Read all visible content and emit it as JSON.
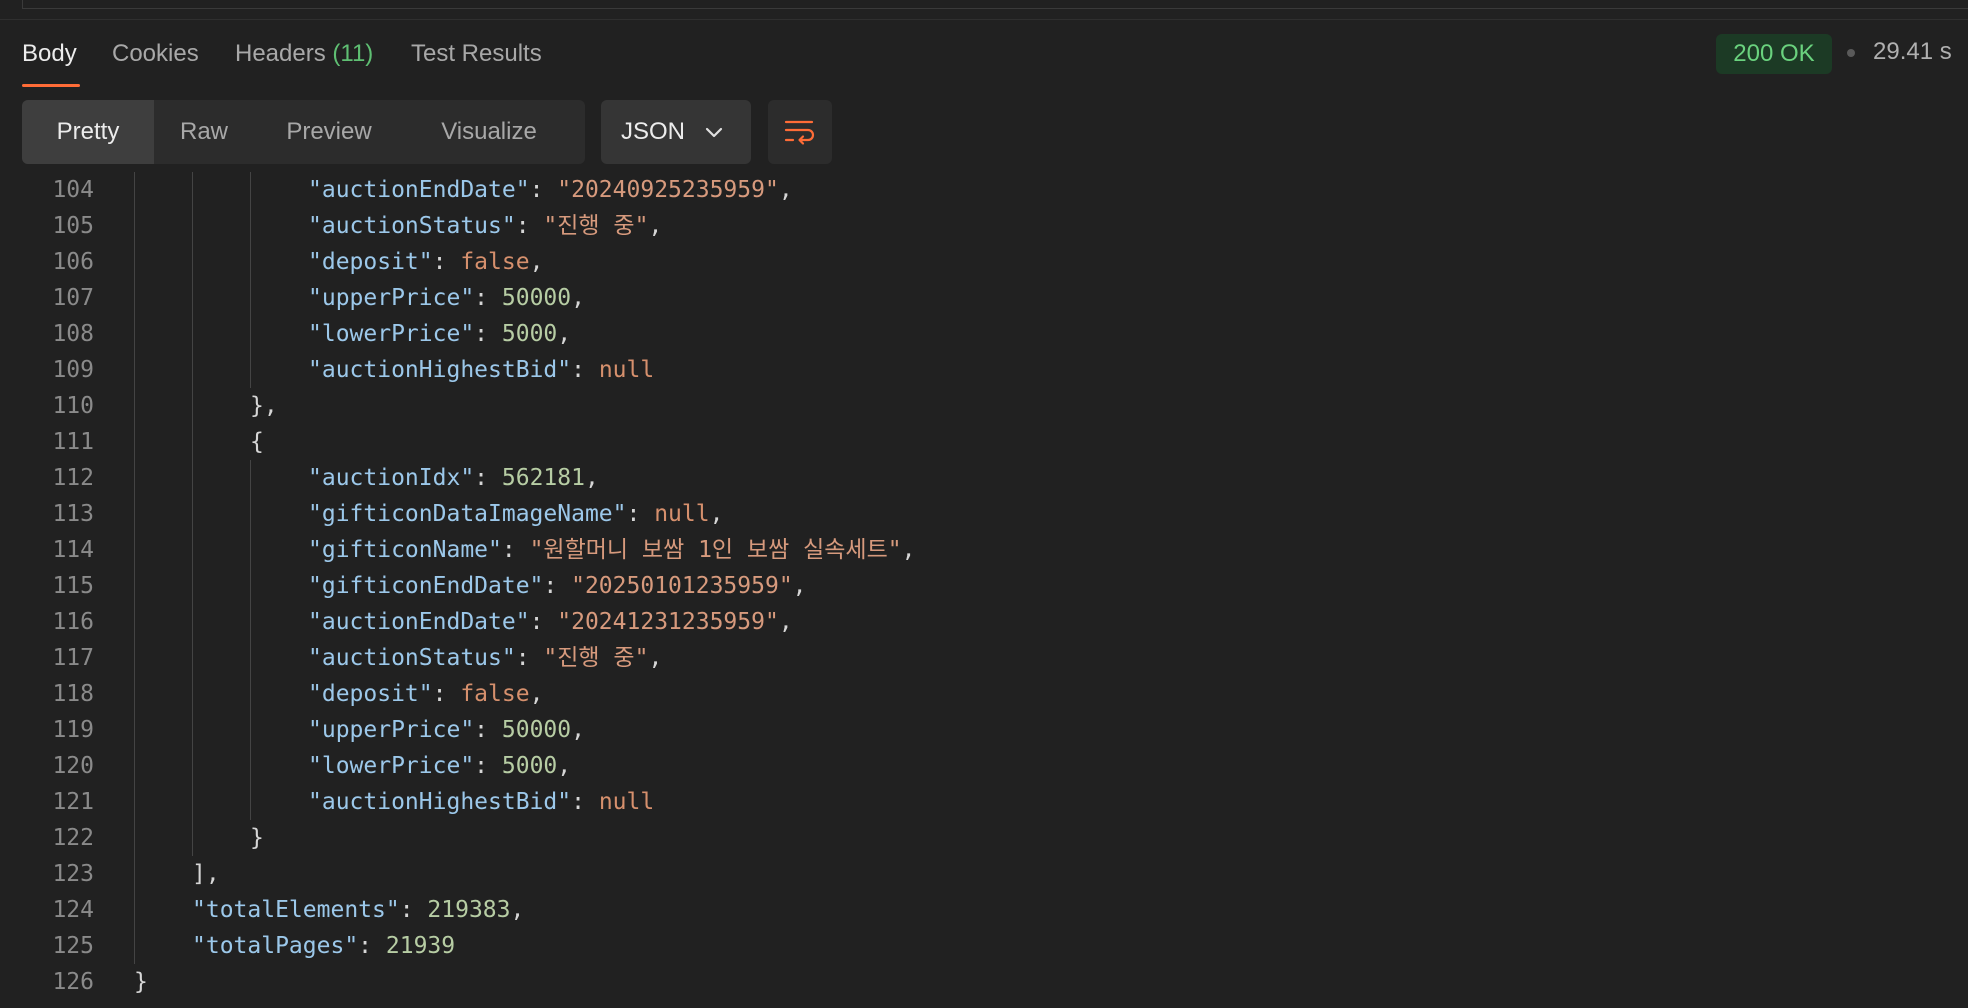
{
  "response_tabs": {
    "body": "Body",
    "cookies": "Cookies",
    "headers": "Headers",
    "headers_count": "(11)",
    "test_results": "Test Results"
  },
  "status": {
    "code": "200 OK",
    "time": "29.41 s"
  },
  "view_modes": {
    "pretty": "Pretty",
    "raw": "Raw",
    "preview": "Preview",
    "visualize": "Visualize"
  },
  "format": {
    "selected": "JSON"
  },
  "icons": {
    "dropdown": "chevron-down-icon",
    "wrap": "wrap-lines-icon"
  },
  "colors": {
    "accent": "#ff6c37",
    "status_ok": "#6ad27e",
    "json_key": "#9cc8ea",
    "json_string": "#d79a7d",
    "json_number": "#b7cda4",
    "json_keyword": "#d6906d"
  },
  "code": {
    "lines": [
      {
        "num": "104",
        "indent": 3,
        "tokens": [
          [
            "k",
            "\"auctionEndDate\""
          ],
          [
            "p",
            ": "
          ],
          [
            "s",
            "\"20240925235959\""
          ],
          [
            "p",
            ","
          ]
        ]
      },
      {
        "num": "105",
        "indent": 3,
        "tokens": [
          [
            "k",
            "\"auctionStatus\""
          ],
          [
            "p",
            ": "
          ],
          [
            "s",
            "\"진행 중\""
          ],
          [
            "p",
            ","
          ]
        ]
      },
      {
        "num": "106",
        "indent": 3,
        "tokens": [
          [
            "k",
            "\"deposit\""
          ],
          [
            "p",
            ": "
          ],
          [
            "kw",
            "false"
          ],
          [
            "p",
            ","
          ]
        ]
      },
      {
        "num": "107",
        "indent": 3,
        "tokens": [
          [
            "k",
            "\"upperPrice\""
          ],
          [
            "p",
            ": "
          ],
          [
            "n",
            "50000"
          ],
          [
            "p",
            ","
          ]
        ]
      },
      {
        "num": "108",
        "indent": 3,
        "tokens": [
          [
            "k",
            "\"lowerPrice\""
          ],
          [
            "p",
            ": "
          ],
          [
            "n",
            "5000"
          ],
          [
            "p",
            ","
          ]
        ]
      },
      {
        "num": "109",
        "indent": 3,
        "tokens": [
          [
            "k",
            "\"auctionHighestBid\""
          ],
          [
            "p",
            ": "
          ],
          [
            "kw",
            "null"
          ]
        ]
      },
      {
        "num": "110",
        "indent": 2,
        "tokens": [
          [
            "p",
            "},"
          ]
        ]
      },
      {
        "num": "111",
        "indent": 2,
        "tokens": [
          [
            "p",
            "{"
          ]
        ]
      },
      {
        "num": "112",
        "indent": 3,
        "tokens": [
          [
            "k",
            "\"auctionIdx\""
          ],
          [
            "p",
            ": "
          ],
          [
            "n",
            "562181"
          ],
          [
            "p",
            ","
          ]
        ]
      },
      {
        "num": "113",
        "indent": 3,
        "tokens": [
          [
            "k",
            "\"gifticonDataImageName\""
          ],
          [
            "p",
            ": "
          ],
          [
            "kw",
            "null"
          ],
          [
            "p",
            ","
          ]
        ]
      },
      {
        "num": "114",
        "indent": 3,
        "tokens": [
          [
            "k",
            "\"gifticonName\""
          ],
          [
            "p",
            ": "
          ],
          [
            "s",
            "\"원할머니 보쌈 1인 보쌈 실속세트\""
          ],
          [
            "p",
            ","
          ]
        ]
      },
      {
        "num": "115",
        "indent": 3,
        "tokens": [
          [
            "k",
            "\"gifticonEndDate\""
          ],
          [
            "p",
            ": "
          ],
          [
            "s",
            "\"20250101235959\""
          ],
          [
            "p",
            ","
          ]
        ]
      },
      {
        "num": "116",
        "indent": 3,
        "tokens": [
          [
            "k",
            "\"auctionEndDate\""
          ],
          [
            "p",
            ": "
          ],
          [
            "s",
            "\"20241231235959\""
          ],
          [
            "p",
            ","
          ]
        ]
      },
      {
        "num": "117",
        "indent": 3,
        "tokens": [
          [
            "k",
            "\"auctionStatus\""
          ],
          [
            "p",
            ": "
          ],
          [
            "s",
            "\"진행 중\""
          ],
          [
            "p",
            ","
          ]
        ]
      },
      {
        "num": "118",
        "indent": 3,
        "tokens": [
          [
            "k",
            "\"deposit\""
          ],
          [
            "p",
            ": "
          ],
          [
            "kw",
            "false"
          ],
          [
            "p",
            ","
          ]
        ]
      },
      {
        "num": "119",
        "indent": 3,
        "tokens": [
          [
            "k",
            "\"upperPrice\""
          ],
          [
            "p",
            ": "
          ],
          [
            "n",
            "50000"
          ],
          [
            "p",
            ","
          ]
        ]
      },
      {
        "num": "120",
        "indent": 3,
        "tokens": [
          [
            "k",
            "\"lowerPrice\""
          ],
          [
            "p",
            ": "
          ],
          [
            "n",
            "5000"
          ],
          [
            "p",
            ","
          ]
        ]
      },
      {
        "num": "121",
        "indent": 3,
        "tokens": [
          [
            "k",
            "\"auctionHighestBid\""
          ],
          [
            "p",
            ": "
          ],
          [
            "kw",
            "null"
          ]
        ]
      },
      {
        "num": "122",
        "indent": 2,
        "tokens": [
          [
            "p",
            "}"
          ]
        ]
      },
      {
        "num": "123",
        "indent": 1,
        "tokens": [
          [
            "p",
            "],"
          ]
        ]
      },
      {
        "num": "124",
        "indent": 1,
        "tokens": [
          [
            "k",
            "\"totalElements\""
          ],
          [
            "p",
            ": "
          ],
          [
            "n",
            "219383"
          ],
          [
            "p",
            ","
          ]
        ]
      },
      {
        "num": "125",
        "indent": 1,
        "tokens": [
          [
            "k",
            "\"totalPages\""
          ],
          [
            "p",
            ": "
          ],
          [
            "n",
            "21939"
          ]
        ]
      },
      {
        "num": "126",
        "indent": 0,
        "tokens": [
          [
            "p",
            "}"
          ]
        ]
      }
    ]
  }
}
